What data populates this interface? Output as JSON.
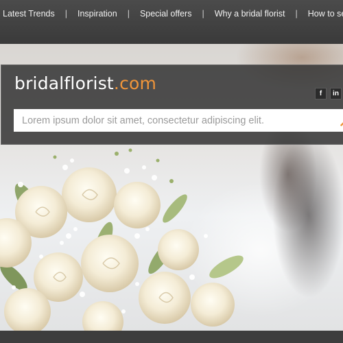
{
  "nav": {
    "items": [
      {
        "label": "Latest Trends"
      },
      {
        "label": "Inspiration"
      },
      {
        "label": "Special offers"
      },
      {
        "label": "Why a bridal florist"
      },
      {
        "label": "How to select a br"
      }
    ],
    "separator": "|"
  },
  "header": {
    "logo_main": "bridalflorist",
    "logo_suffix": ".com",
    "search_value": "Lorem ipsum dolor sit amet, consectetur adipiscing elit."
  },
  "social": {
    "facebook": "f",
    "linkedin": "in"
  },
  "icons": {
    "search": "search-icon",
    "facebook": "facebook-icon",
    "linkedin": "linkedin-icon"
  },
  "colors": {
    "nav_bg": "#424242",
    "accent_orange": "#f0953a",
    "header_overlay": "#343434"
  }
}
